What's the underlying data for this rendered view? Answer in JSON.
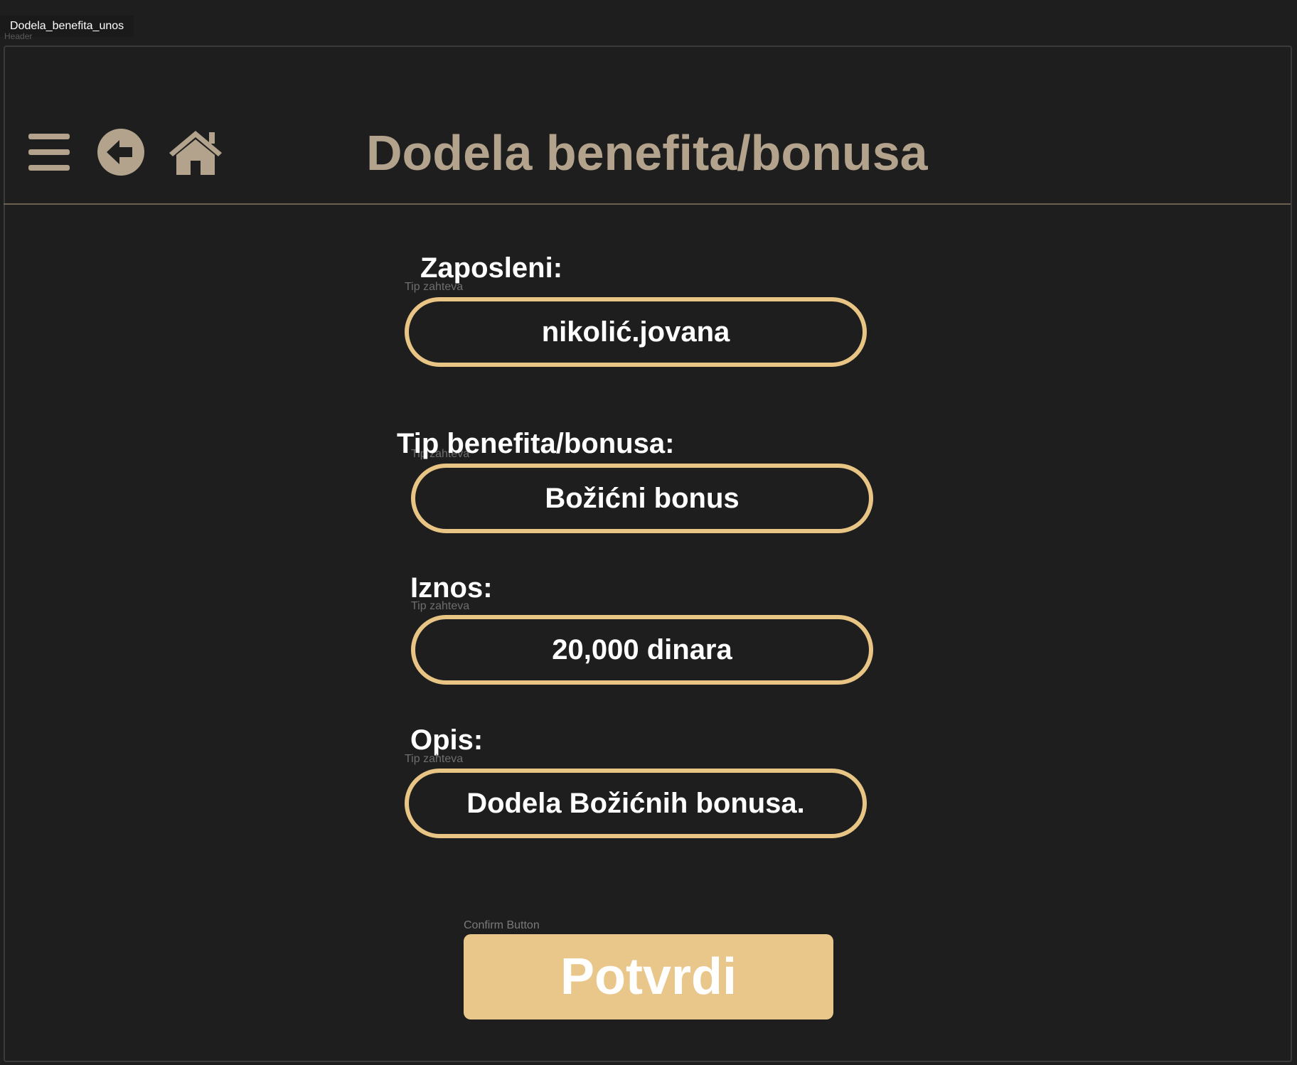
{
  "frame": {
    "tab_label": "Dodela_benefita_unos",
    "under_label": "Header"
  },
  "header": {
    "title": "Dodela benefita/bonusa",
    "icons": [
      "menu-icon",
      "back-arrow-icon",
      "home-icon"
    ],
    "icon_color": "#b3a38c"
  },
  "form": {
    "employee": {
      "label": "Zaposleni:",
      "hint": "Tip zahteva",
      "value": "nikolić.jovana"
    },
    "benefit_type": {
      "label": "Tip benefita/bonusa:",
      "hint": "Tip zahteva",
      "value": "Božićni bonus"
    },
    "amount": {
      "label": "Iznos:",
      "hint": "Tip zahteva",
      "value": "20,000 dinara"
    },
    "description": {
      "label": "Opis:",
      "hint": "Tip zahteva",
      "value": "Dodela Božićnih bonusa."
    }
  },
  "confirm": {
    "hint": "Confirm Button",
    "label": "Potvrdi"
  },
  "colors": {
    "background": "#1e1e1e",
    "accent": "#e8c585",
    "title": "#b3a38c",
    "button": "#e9c78a"
  }
}
